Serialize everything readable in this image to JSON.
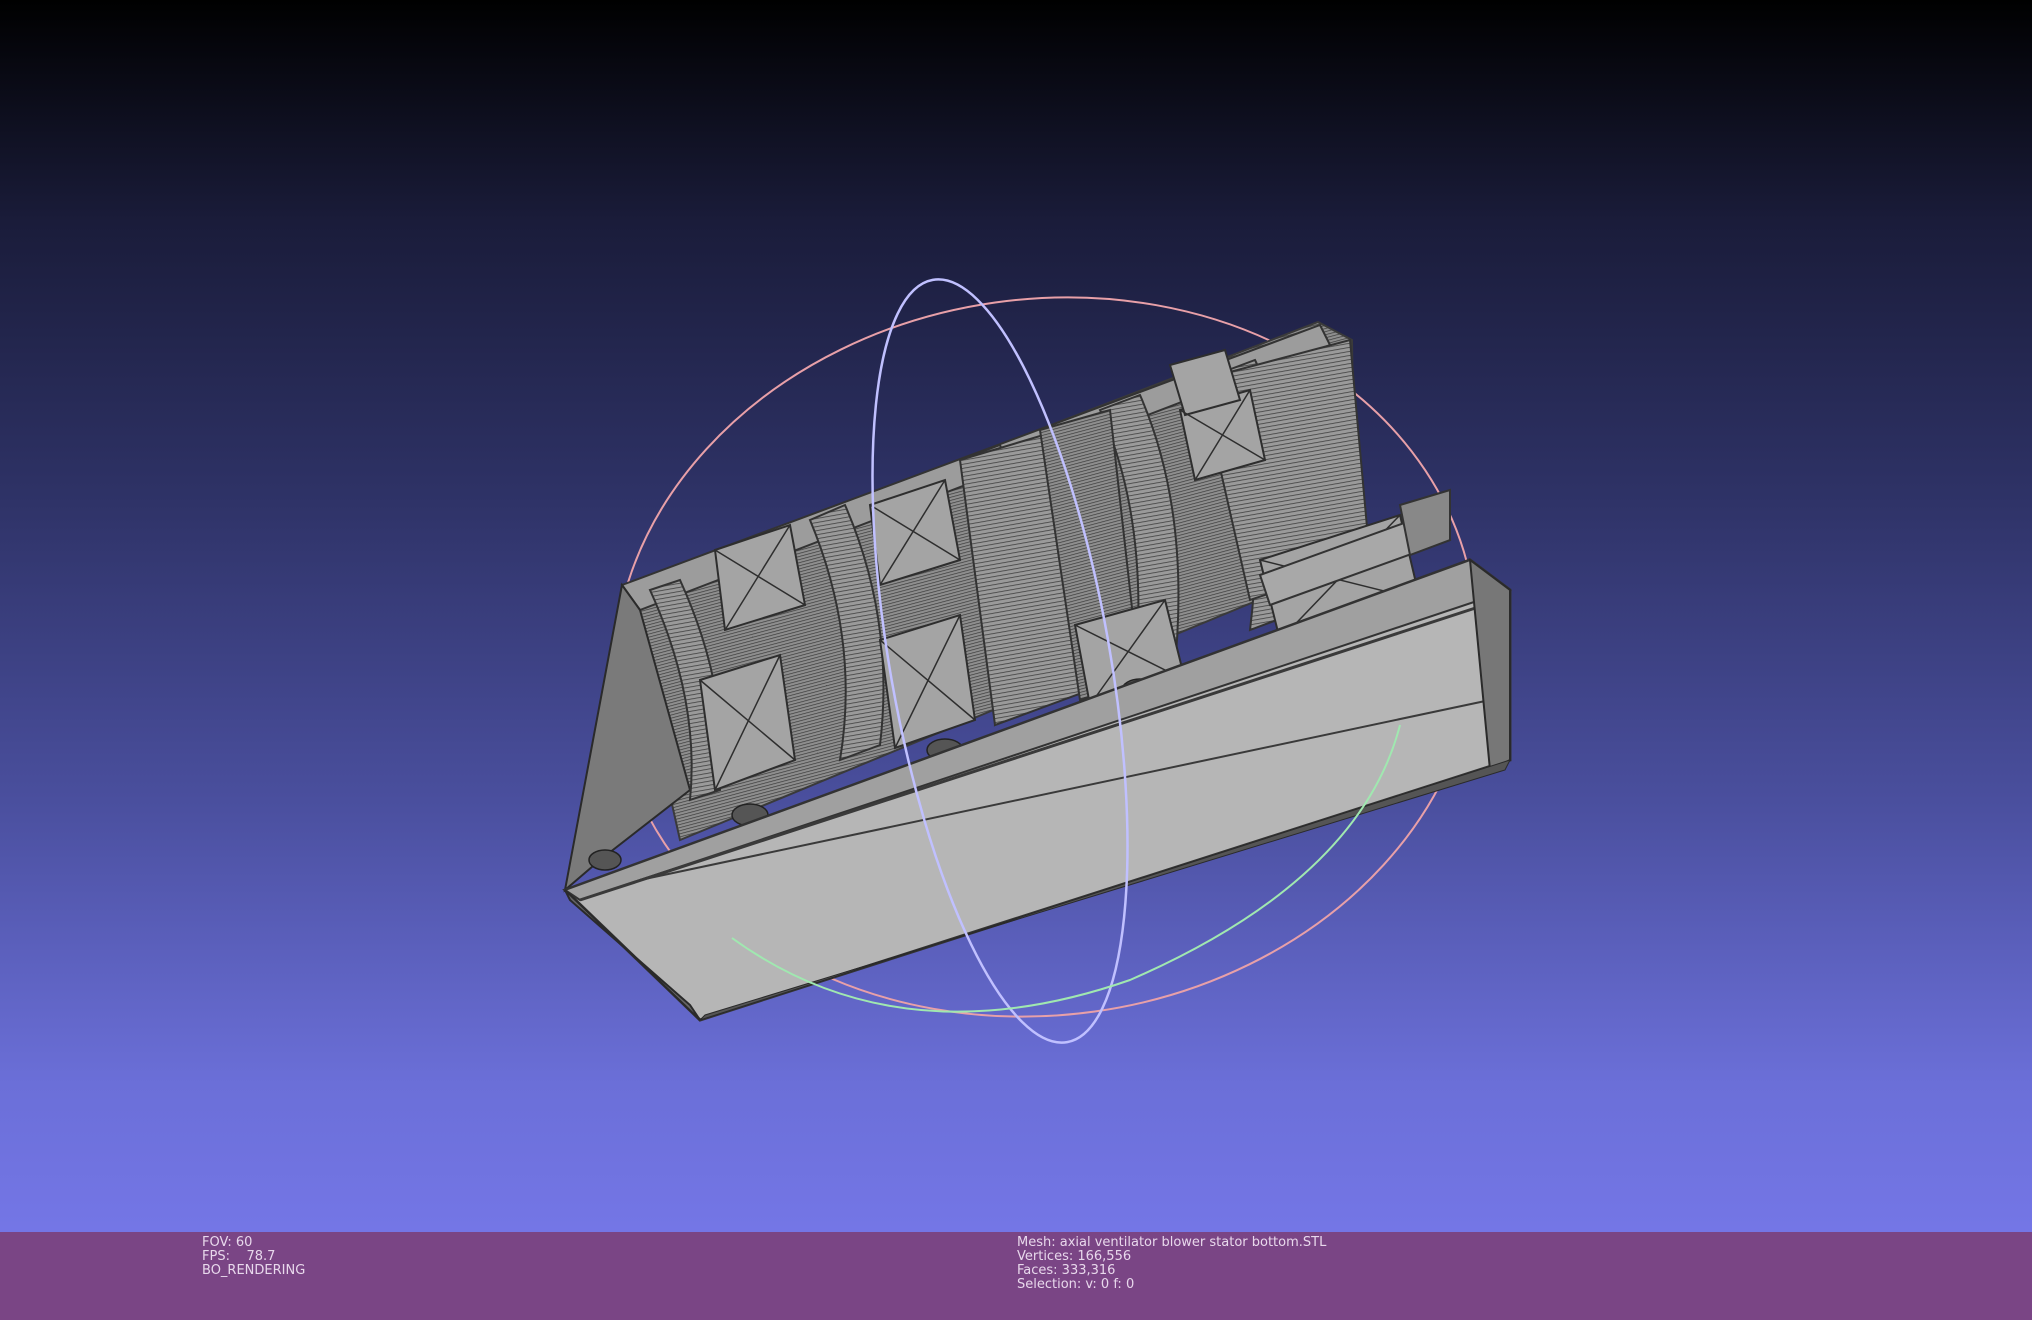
{
  "viewer": {
    "gizmo_colors": {
      "ring_x": "#e8a0a8",
      "ring_y": "#c0c0ff",
      "ring_z": "#a0e8b0"
    },
    "mesh_fill": "#b8b8b8",
    "mesh_edge": "#3a3a3a"
  },
  "status": {
    "left": {
      "fov": "FOV: 60",
      "fps": "FPS:    78.7",
      "mode": "BO_RENDERING"
    },
    "right": {
      "mesh": "Mesh: axial ventilator blower stator bottom.STL",
      "vertices": "Vertices: 166,556",
      "faces": "Faces: 333,316",
      "selection": "Selection: v: 0 f: 0"
    }
  }
}
